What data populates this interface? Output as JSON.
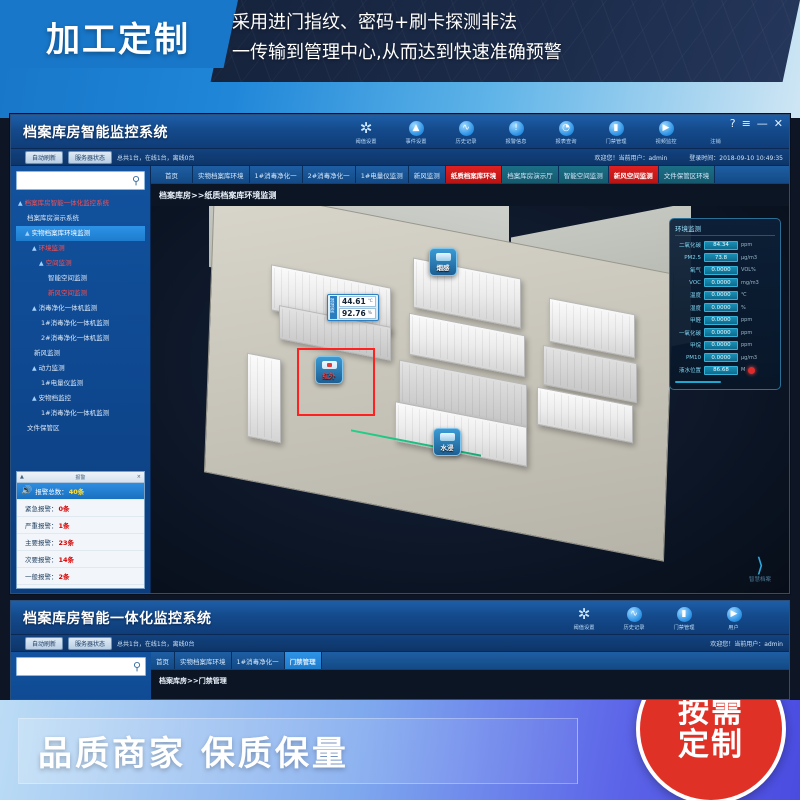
{
  "top_banner": {
    "badge": "加工定制",
    "line1": "采用进门指纹、密码+刷卡探测非法",
    "line2": "一传输到管理中心,从而达到快速准确预警"
  },
  "bottom_banner": {
    "text": "品质商家  保质保量",
    "seal_line1": "按需",
    "seal_line2": "定制",
    "corner_left_1": "加工定制",
    "corner_left_2": "品质商家",
    "corner_right_1": "按需",
    "corner_right_2": "定制"
  },
  "app": {
    "title": "档案库房智能监控系统",
    "window_controls": [
      "?",
      "≡",
      "—",
      "✕"
    ],
    "toolbar": [
      {
        "label": "阈值设置",
        "icon": "gear-icon",
        "glyph": "✲"
      },
      {
        "label": "事件设置",
        "icon": "bell-icon",
        "glyph": "▲"
      },
      {
        "label": "历史记录",
        "icon": "wave-icon",
        "glyph": "∿"
      },
      {
        "label": "报警信息",
        "icon": "warning-icon",
        "glyph": "!"
      },
      {
        "label": "报表查询",
        "icon": "chart-icon",
        "glyph": "◔"
      },
      {
        "label": "门禁管理",
        "icon": "door-icon",
        "glyph": "▮"
      },
      {
        "label": "视频监控",
        "icon": "play-icon",
        "glyph": "▶"
      },
      {
        "label": "注销",
        "icon": "logout-icon",
        "glyph": ""
      }
    ],
    "status": {
      "btn_refresh": "自动刷新",
      "btn_server": "服务器状态",
      "devices": "总共1台，在线1台，离线0台",
      "welcome": "欢迎您！当前用户：admin",
      "login_time": "登录时间：2018-09-10 10:49:35"
    },
    "search_placeholder": "",
    "tree": [
      {
        "label": "档案库房智能一体化监控系统",
        "level": 0,
        "arrow": "▲",
        "state": "red"
      },
      {
        "label": "档案库房演示系统",
        "level": 1,
        "arrow": "",
        "state": "normal"
      },
      {
        "label": "实物档案库环境监测",
        "level": 1,
        "arrow": "▲",
        "state": "selected"
      },
      {
        "label": "环境监测",
        "level": 2,
        "arrow": "▲",
        "state": "red"
      },
      {
        "label": "空间监测",
        "level": 3,
        "arrow": "▲",
        "state": "red"
      },
      {
        "label": "智能空间监测",
        "level": 4,
        "arrow": "",
        "state": "normal"
      },
      {
        "label": "新风空间监测",
        "level": 4,
        "arrow": "",
        "state": "red"
      },
      {
        "label": "消毒净化一体机监测",
        "level": 2,
        "arrow": "▲",
        "state": "normal"
      },
      {
        "label": "1#消毒净化一体机监测",
        "level": 3,
        "arrow": "",
        "state": "normal"
      },
      {
        "label": "2#消毒净化一体机监测",
        "level": 3,
        "arrow": "",
        "state": "normal"
      },
      {
        "label": "新风监测",
        "level": 2,
        "arrow": "",
        "state": "normal"
      },
      {
        "label": "动力监测",
        "level": 2,
        "arrow": "▲",
        "state": "normal"
      },
      {
        "label": "1#电量仪监测",
        "level": 3,
        "arrow": "",
        "state": "normal"
      },
      {
        "label": "安物档监控",
        "level": 2,
        "arrow": "▲",
        "state": "normal"
      },
      {
        "label": "1#消毒净化一体机监测",
        "level": 3,
        "arrow": "",
        "state": "normal"
      },
      {
        "label": "文件保管区",
        "level": 1,
        "arrow": "",
        "state": "normal"
      }
    ],
    "alarms": {
      "header_left": "▲",
      "header_mid": "报警",
      "header_right": "×",
      "rows": [
        {
          "label": "报警总数：",
          "count": "40条",
          "highlight": true
        },
        {
          "label": "紧急报警：",
          "count": "0条",
          "highlight": false
        },
        {
          "label": "严重报警：",
          "count": "1条",
          "highlight": false
        },
        {
          "label": "主要报警：",
          "count": "23条",
          "highlight": false
        },
        {
          "label": "次要报警：",
          "count": "14条",
          "highlight": false
        },
        {
          "label": "一般报警：",
          "count": "2条",
          "highlight": false
        }
      ]
    },
    "tabs": [
      {
        "label": "首页",
        "style": "home"
      },
      {
        "label": "实物档案库环境",
        "style": "normal"
      },
      {
        "label": "1#消毒净化一",
        "style": "normal"
      },
      {
        "label": "2#消毒净化一",
        "style": "normal"
      },
      {
        "label": "1#电量仪监测",
        "style": "normal"
      },
      {
        "label": "新风监测",
        "style": "normal"
      },
      {
        "label": "纸质档案库环境",
        "style": "active"
      },
      {
        "label": "档案库房演示厅",
        "style": "teal"
      },
      {
        "label": "智能空间监测",
        "style": "teal"
      },
      {
        "label": "新风空间监测",
        "style": "active"
      },
      {
        "label": "文件保管区环境",
        "style": "teal"
      }
    ],
    "breadcrumb": "档案库房>>纸质档案库环境监测",
    "scene": {
      "temp_humi_tag": "温湿度",
      "temp_value": "44.61",
      "temp_unit": "℃",
      "humi_value": "92.76",
      "humi_unit": "%",
      "smoke_label": "烟感",
      "ir_label": "红外",
      "water_label": "水浸",
      "logo_mark": "⟩",
      "logo_text": "智慧档案"
    },
    "env_panel": {
      "title": "环境监测",
      "rows": [
        {
          "key": "二氧化碳",
          "value": "84.34",
          "unit": "ppm"
        },
        {
          "key": "PM2.5",
          "value": "73.8",
          "unit": "μg/m3"
        },
        {
          "key": "氧气",
          "value": "0.0000",
          "unit": "VOL%"
        },
        {
          "key": "VOC",
          "value": "0.0000",
          "unit": "mg/m3"
        },
        {
          "key": "温度",
          "value": "0.0000",
          "unit": "℃"
        },
        {
          "key": "湿度",
          "value": "0.0000",
          "unit": "%"
        },
        {
          "key": "甲醛",
          "value": "0.0000",
          "unit": "ppm"
        },
        {
          "key": "一氧化碳",
          "value": "0.0000",
          "unit": "ppm"
        },
        {
          "key": "甲烷",
          "value": "0.0000",
          "unit": "ppm"
        },
        {
          "key": "PM10",
          "value": "0.0000",
          "unit": "μg/m3"
        },
        {
          "key": "液水位置",
          "value": "86.68",
          "unit": "M"
        }
      ]
    }
  },
  "app2": {
    "title": "档案库房智能一体化监控系统",
    "toolbar": [
      {
        "label": "阈值设置",
        "glyph": "✲"
      },
      {
        "label": "历史记录",
        "glyph": "∿"
      },
      {
        "label": "门禁管理",
        "glyph": "▮"
      },
      {
        "label": "用户",
        "glyph": "▶"
      }
    ],
    "status": {
      "btn_refresh": "自动刷新",
      "btn_server": "服务器状态",
      "devices": "总共1台，在线1台，离线0台",
      "welcome": "欢迎您！当前用户：admin"
    },
    "tabs": [
      {
        "label": "首页",
        "style": "normal"
      },
      {
        "label": "实物档案库环境",
        "style": "normal"
      },
      {
        "label": "1#消毒净化一",
        "style": "normal"
      },
      {
        "label": "门禁管理",
        "style": "sel"
      }
    ],
    "breadcrumb": "档案库房>>门禁管理"
  },
  "colors": {
    "accent_blue": "#1877c9",
    "alarm_red": "#e02020",
    "panel_cyan": "#35b0d6",
    "seal_red": "#e03127"
  }
}
